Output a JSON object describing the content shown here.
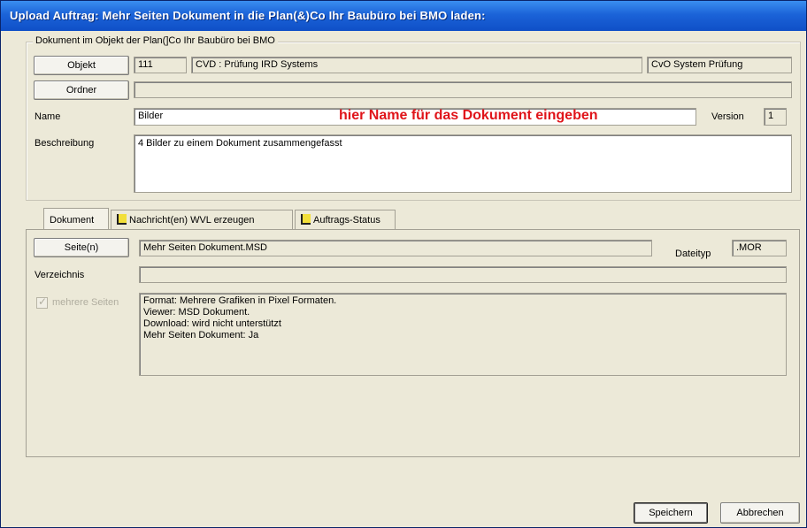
{
  "window": {
    "title": "Upload Auftrag: Mehr Seiten Dokument in die Plan(&)Co Ihr Baubüro bei BMO laden:"
  },
  "group_top": {
    "caption": "Dokument im Objekt der Plan(]Co Ihr Baubüro bei BMO",
    "objekt_button": "Objekt",
    "objekt_number": "111",
    "objekt_name": "CVD : Prüfung IRD Systems",
    "objekt_extra": "CvO System Prüfung",
    "ordner_button": "Ordner",
    "ordner_value": "",
    "name_label": "Name",
    "name_value": "Bilder",
    "name_hint": "hier Name für das Dokument eingeben",
    "version_label": "Version",
    "version_value": "1",
    "beschreibung_label": "Beschreibung",
    "beschreibung_value": "4 Bilder zu einem Dokument zusammengefasst"
  },
  "tabs": [
    {
      "label": "Dokument",
      "active": true
    },
    {
      "label": "Nachricht(en) WVL erzeugen",
      "active": false
    },
    {
      "label": "Auftrags-Status",
      "active": false
    }
  ],
  "dokument_tab": {
    "seiten_button": "Seite(n)",
    "seiten_value": "Mehr Seiten Dokument.MSD",
    "dateityp_label": "Dateityp",
    "dateityp_value": ".MOR",
    "verzeichnis_label": "Verzeichnis",
    "verzeichnis_value": "",
    "mehrere_seiten_label": "mehrere Seiten",
    "mehrere_seiten_checked": true,
    "info_lines": [
      "Format: Mehrere Grafiken in Pixel Formaten.",
      "Viewer: MSD Dokument.",
      "Download: wird nicht unterstützt",
      "Mehr Seiten Dokument: Ja"
    ]
  },
  "footer": {
    "save_button": "Speichern",
    "cancel_button": "Abbrechen"
  },
  "colors": {
    "titlebar": "#1b63d8",
    "hint": "#e0141a",
    "window_bg": "#ece9d8"
  }
}
